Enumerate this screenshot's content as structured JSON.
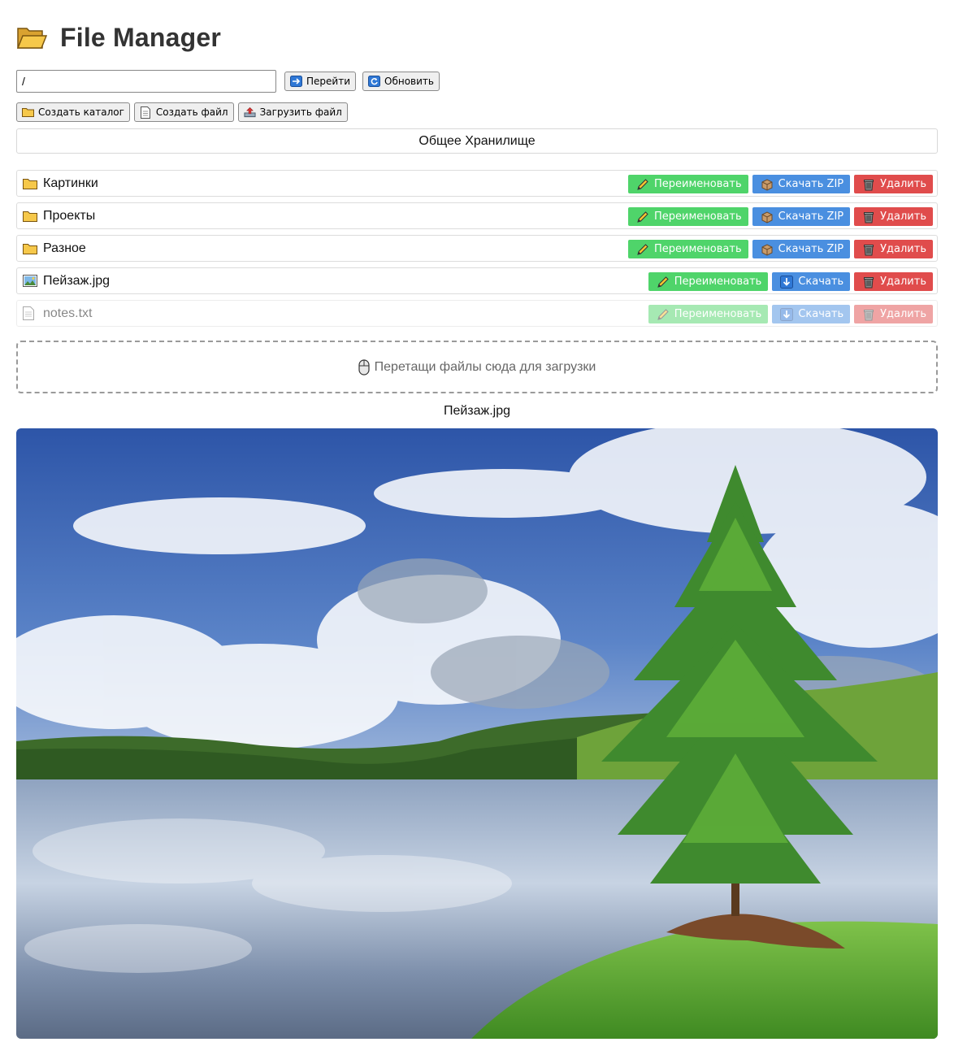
{
  "header": {
    "icon": "open-folder-icon",
    "title": "File Manager"
  },
  "path_bar": {
    "path_value": "/",
    "go_label": "Перейти",
    "refresh_label": "Обновить"
  },
  "actions": {
    "create_dir_label": "Создать каталог",
    "create_file_label": "Создать файл",
    "upload_label": "Загрузить файл"
  },
  "storage": {
    "label": "Общее Хранилище"
  },
  "files": [
    {
      "name": "Картинки",
      "type": "folder",
      "icon": "folder-icon",
      "rename": "Переименовать",
      "download": "Скачать ZIP",
      "delete": "Удалить",
      "disabled": false
    },
    {
      "name": "Проекты",
      "type": "folder",
      "icon": "folder-icon",
      "rename": "Переименовать",
      "download": "Скачать ZIP",
      "delete": "Удалить",
      "disabled": false
    },
    {
      "name": "Разное",
      "type": "folder",
      "icon": "folder-icon",
      "rename": "Переименовать",
      "download": "Скачать ZIP",
      "delete": "Удалить",
      "disabled": false
    },
    {
      "name": "Пейзаж.jpg",
      "type": "image",
      "icon": "image-file-icon",
      "rename": "Переименовать",
      "download": "Скачать",
      "delete": "Удалить",
      "disabled": false
    },
    {
      "name": "notes.txt",
      "type": "text",
      "icon": "text-file-icon",
      "rename": "Переименовать",
      "download": "Скачать",
      "delete": "Удалить",
      "disabled": true
    }
  ],
  "dropzone": {
    "icon": "mouse-icon",
    "text": "Перетащи файлы сюда для загрузки"
  },
  "preview": {
    "title": "Пейзаж.jpg"
  },
  "colors": {
    "rename": "#4fd46a",
    "download": "#4a8fe0",
    "delete": "#e04c4c"
  }
}
